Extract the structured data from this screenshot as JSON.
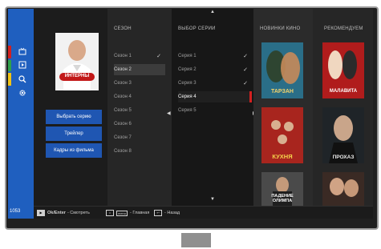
{
  "left_rail": {
    "count": "1053",
    "strip_colors": [
      "#d32020",
      "#2fa14a",
      "#f2c414"
    ],
    "icons": [
      "tv-icon",
      "play-square-icon",
      "search-icon",
      "gear-icon"
    ]
  },
  "actions": {
    "choose_series": "Выбрать серию",
    "trailer": "Трейлер",
    "stills": "Кадры из фильма"
  },
  "poster_title": "ИНТЕРНЫ",
  "seasons": {
    "header": "СЕЗОН",
    "items": [
      "Сезон 1",
      "Сезон 2",
      "Сезон 3",
      "Сезон 4",
      "Сезон 5",
      "Сезон 6",
      "Сезон 7",
      "Сезон 8"
    ],
    "selected_index": 1,
    "checked_index": 0
  },
  "episodes": {
    "header": "ВЫБОР СЕРИИ",
    "items": [
      "Серия 1",
      "Серия 2",
      "Серия 3",
      "Серия 4",
      "Серия 5"
    ],
    "active_index": 3,
    "checked_indexes": [
      0,
      1,
      2
    ]
  },
  "new_movies": {
    "header": "НОВИНКИ КИНО",
    "posters": [
      {
        "title": "ТАРЗАН",
        "color": "#2a6e88"
      },
      {
        "title": "КУХНЯ",
        "color": "#a8251e"
      },
      {
        "title": "ПАДЕНИЕ ОЛИМПА",
        "color": "#4a4a4a"
      }
    ]
  },
  "recommended": {
    "header": "РЕКОМЕНДУЕМ",
    "posters": [
      {
        "title": "МАЛАВИТА",
        "color": "#b01c1c"
      },
      {
        "title": "ПРОХАЗ",
        "color": "#1f2428"
      },
      {
        "title": "",
        "color": "#3a2a24"
      }
    ]
  },
  "bottom_hints": {
    "ok": "Ok/Enter",
    "watch": "- Смотреть",
    "menu_key": "menu",
    "menu_label": "- Главная",
    "back_label": "- Назад"
  }
}
